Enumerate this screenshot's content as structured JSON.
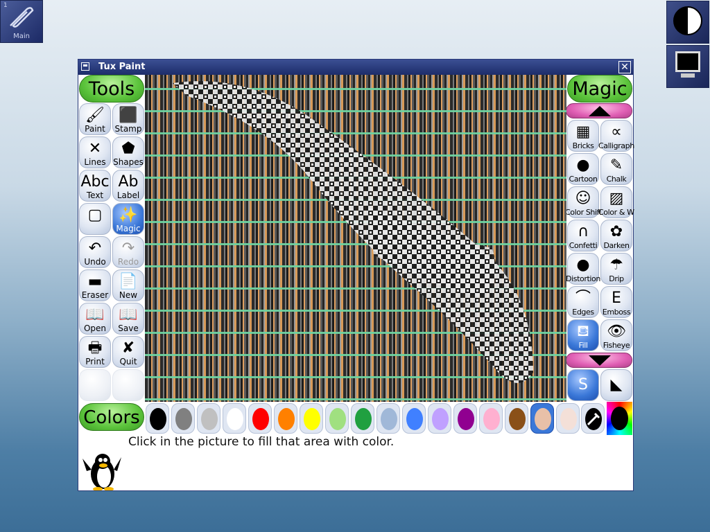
{
  "desktop": {
    "main_icon_label": "Main",
    "main_icon_number": "1"
  },
  "window": {
    "title": "Tux Paint",
    "close_glyph": "✕"
  },
  "tools": {
    "header": "Tools",
    "items": [
      {
        "label": "Paint",
        "icon": "paintbrush-icon",
        "glyph": "🖌"
      },
      {
        "label": "Stamp",
        "icon": "stamp-icon",
        "glyph": "⬛"
      },
      {
        "label": "Lines",
        "icon": "lines-icon",
        "glyph": "✕"
      },
      {
        "label": "Shapes",
        "icon": "pentagon-icon",
        "glyph": "⬟"
      },
      {
        "label": "Text",
        "icon": "text-icon",
        "glyph": "Abc"
      },
      {
        "label": "Label",
        "icon": "label-icon",
        "glyph": "Ab"
      },
      {
        "label": "",
        "icon": "square-icon",
        "glyph": "▢"
      },
      {
        "label": "Magic",
        "icon": "magic-wand-icon",
        "glyph": "✨"
      },
      {
        "label": "Undo",
        "icon": "undo-icon",
        "glyph": "↶"
      },
      {
        "label": "Redo",
        "icon": "redo-icon",
        "glyph": "↷"
      },
      {
        "label": "Eraser",
        "icon": "eraser-icon",
        "glyph": "▬"
      },
      {
        "label": "New",
        "icon": "new-page-icon",
        "glyph": "📄"
      },
      {
        "label": "Open",
        "icon": "open-book-icon",
        "glyph": "📖"
      },
      {
        "label": "Save",
        "icon": "save-icon",
        "glyph": "📖"
      },
      {
        "label": "Print",
        "icon": "printer-icon",
        "glyph": "🖶"
      },
      {
        "label": "Quit",
        "icon": "quit-icon",
        "glyph": "✘"
      }
    ],
    "selected": "Magic",
    "disabled": [
      "Redo"
    ]
  },
  "magic": {
    "header": "Magic",
    "items": [
      {
        "label": "Bricks",
        "icon": "bricks-icon",
        "glyph": "▦"
      },
      {
        "label": "Calligraphy",
        "icon": "calligraphy-icon",
        "glyph": "∝"
      },
      {
        "label": "Cartoon",
        "icon": "cartoon-icon",
        "glyph": "●"
      },
      {
        "label": "Chalk",
        "icon": "chalk-icon",
        "glyph": "✎"
      },
      {
        "label": "Color Shift",
        "icon": "color-shift-icon",
        "glyph": "☺"
      },
      {
        "label": "Color & White",
        "icon": "color-white-icon",
        "glyph": "▨"
      },
      {
        "label": "Confetti",
        "icon": "confetti-icon",
        "glyph": "∩"
      },
      {
        "label": "Darken",
        "icon": "darken-icon",
        "glyph": "✿"
      },
      {
        "label": "Distortion",
        "icon": "distortion-icon",
        "glyph": "●"
      },
      {
        "label": "Drip",
        "icon": "drip-icon",
        "glyph": "☂"
      },
      {
        "label": "Edges",
        "icon": "edges-icon",
        "glyph": "⌒"
      },
      {
        "label": "Emboss",
        "icon": "emboss-icon",
        "glyph": "E"
      },
      {
        "label": "Fill",
        "icon": "fill-bucket-icon",
        "glyph": "⛾"
      },
      {
        "label": "Fisheye",
        "icon": "fisheye-icon",
        "glyph": "👁"
      }
    ],
    "selected": "Fill",
    "options": [
      {
        "icon": "magic-brush-mode-icon",
        "glyph": "S",
        "selected": true
      },
      {
        "icon": "magic-fullscreen-mode-icon",
        "glyph": "◣",
        "selected": false
      }
    ]
  },
  "colors": {
    "header": "Colors",
    "swatches": [
      "#000000",
      "#808080",
      "#c0c0c0",
      "#ffffff",
      "#ff0000",
      "#ff8000",
      "#ffff00",
      "#a0e080",
      "#20a040",
      "#a0b8d8",
      "#4080ff",
      "#c0a0ff",
      "#900090",
      "#ffb0d0",
      "#8a5018",
      "#e8c0a8",
      "#f4e0d8"
    ],
    "selected_index": 15,
    "picker_icon": "color-picker-icon",
    "rainbow_icon": "rainbow-palette-icon"
  },
  "status": {
    "message": "Click in the picture to fill that area with color."
  },
  "mascot": {
    "icon": "tux-penguin-icon"
  }
}
